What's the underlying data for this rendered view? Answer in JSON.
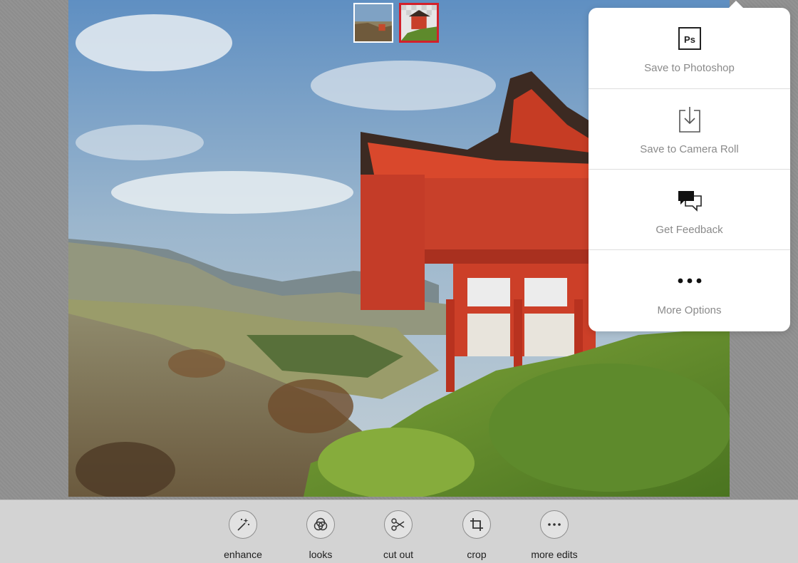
{
  "thumbnails": [
    {
      "icon": "landscape-thumbnail",
      "selected": false
    },
    {
      "icon": "pagoda-cutout-thumbnail",
      "selected": true
    }
  ],
  "share_menu": {
    "items": [
      {
        "label": "Save to Photoshop",
        "icon": "photoshop-icon"
      },
      {
        "label": "Save to Camera Roll",
        "icon": "download-tray-icon"
      },
      {
        "label": "Get Feedback",
        "icon": "speech-bubbles-icon"
      },
      {
        "label": "More Options",
        "icon": "ellipsis-icon"
      }
    ]
  },
  "toolbar": {
    "items": [
      {
        "label": "enhance",
        "icon": "magic-wand-icon"
      },
      {
        "label": "looks",
        "icon": "looks-circles-icon"
      },
      {
        "label": "cut out",
        "icon": "scissors-icon"
      },
      {
        "label": "crop",
        "icon": "crop-icon"
      },
      {
        "label": "more edits",
        "icon": "ellipsis-icon"
      }
    ]
  },
  "colors": {
    "accent_selected": "#d3202a",
    "popover_bg": "#ffffff",
    "toolbar_bg": "#d3d3d3",
    "label_gray": "#8a8a8a"
  }
}
